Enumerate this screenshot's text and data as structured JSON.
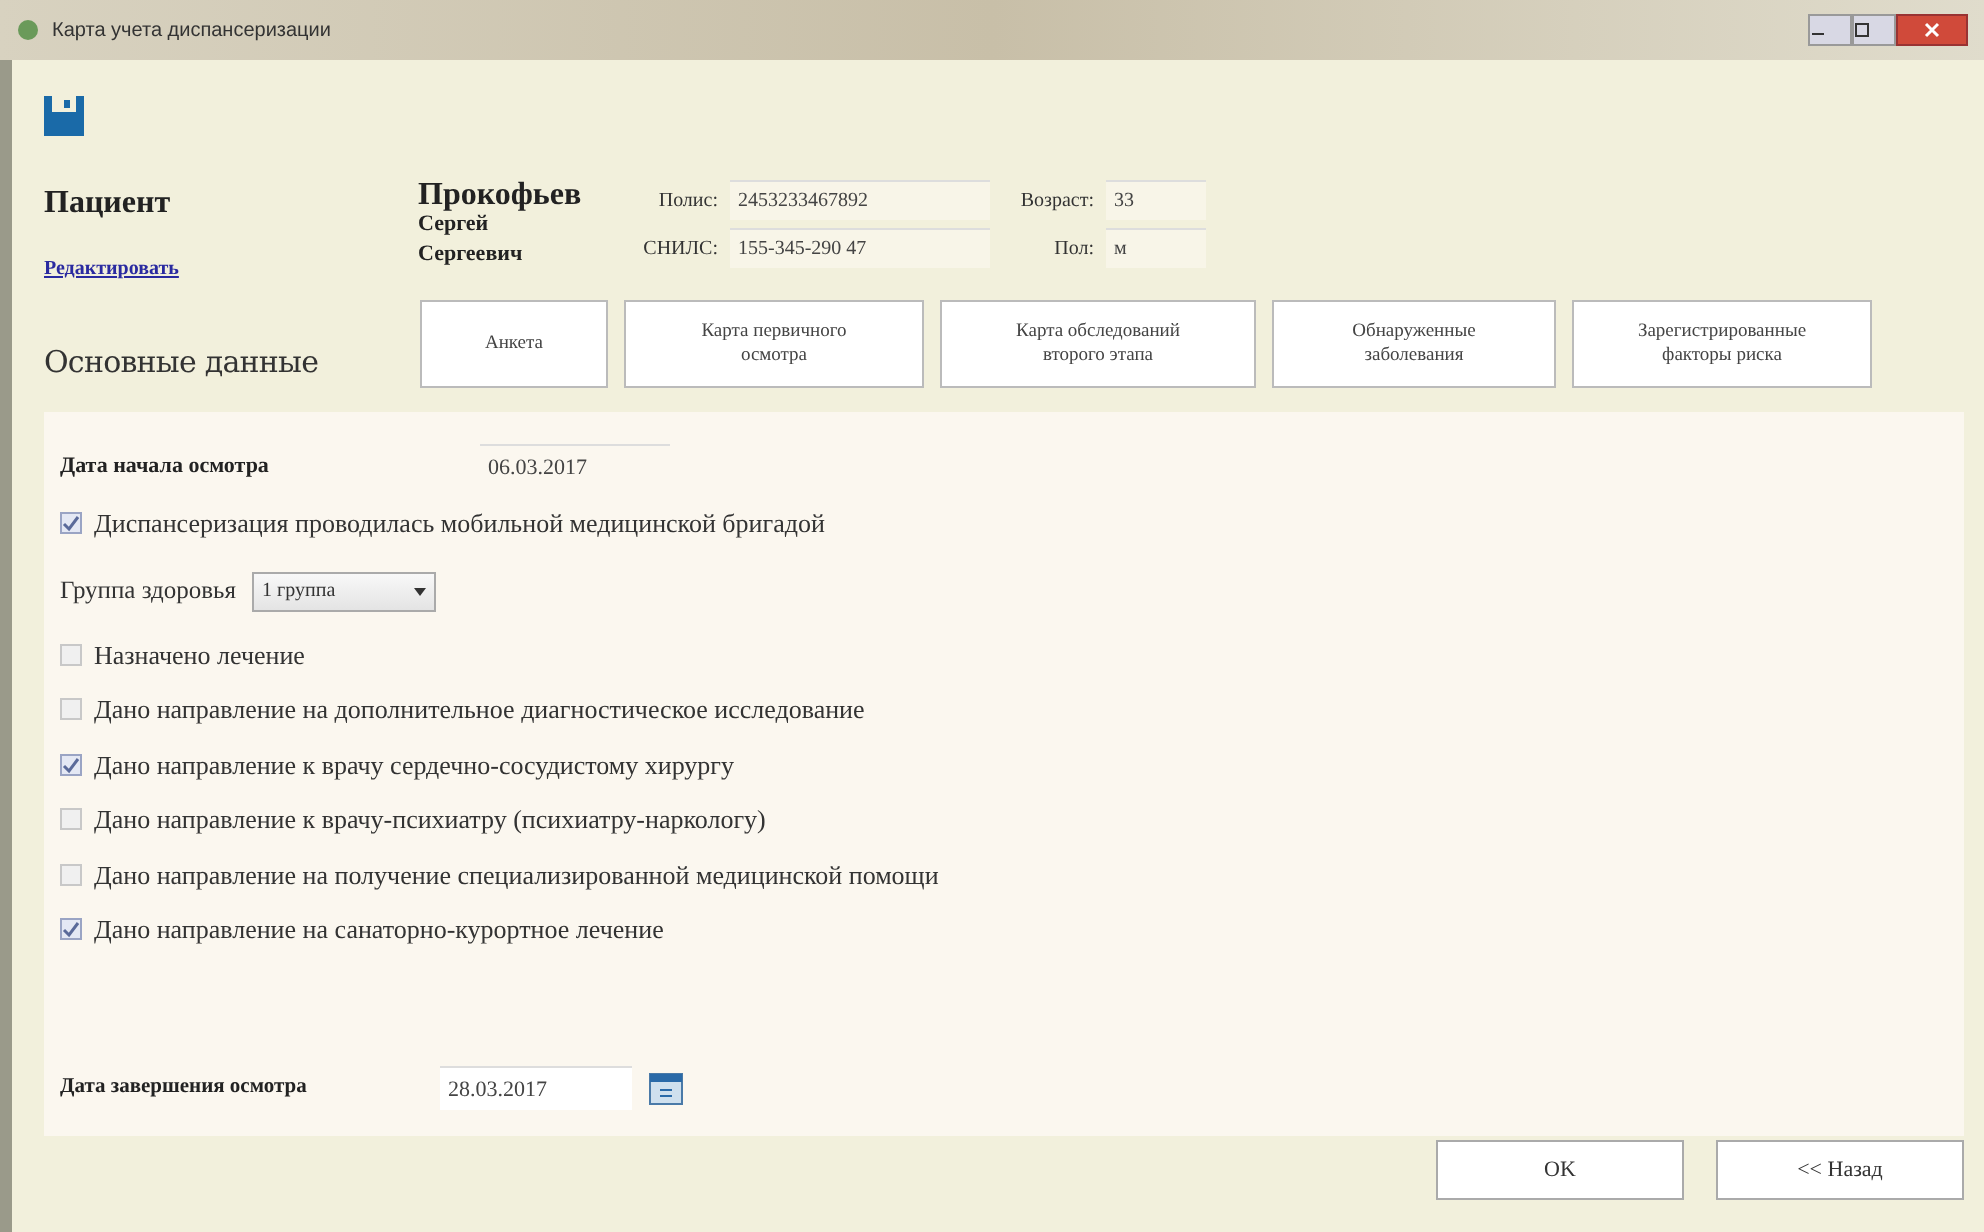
{
  "window": {
    "title": "Карта учета диспансеризации"
  },
  "patient": {
    "heading": "Пациент",
    "edit_link": "Редактировать",
    "last_name": "Прокофьев",
    "first_name": "Сергей",
    "patronymic": "Сергеевич",
    "fields": [
      {
        "label": "Полис:",
        "value": "2453233467892"
      },
      {
        "label": "СНИЛС:",
        "value": "155-345-290 47"
      }
    ],
    "small_fields": [
      {
        "label": "Возраст:",
        "value": "33"
      },
      {
        "label": "Пол:",
        "value": "м"
      }
    ]
  },
  "section_title": "Основные данные",
  "nav_buttons": [
    "Анкета",
    "Карта первичного осмотра",
    "Карта обследований второго этапа",
    "Обнаруженные заболевания",
    "Зарегистрированные факторы риска"
  ],
  "start_date": {
    "label": "Дата начала осмотра",
    "value": "06.03.2017"
  },
  "mobile_team": {
    "label": "Диспансеризация проводилась мобильной медицинской бригадой",
    "checked": true
  },
  "health_group": {
    "label": "Группа здоровья",
    "value": "1 группа"
  },
  "options": [
    {
      "label": "Назначено лечение",
      "checked": false
    },
    {
      "label": "Дано направление на дополнительное диагностическое исследование",
      "checked": false
    },
    {
      "label": "Дано направление к врачу сердечно-сосудистому хирургу",
      "checked": true
    },
    {
      "label": "Дано направление к врачу-психиатру (психиатру-наркологу)",
      "checked": false
    },
    {
      "label": "Дано направление на получение специализированной медицинской помощи",
      "checked": false
    },
    {
      "label": "Дано направление на санаторно-курортное лечение",
      "checked": true
    }
  ],
  "end_date": {
    "label": "Дата завершения осмотра",
    "value": "28.03.2017"
  },
  "buttons": [
    "OK",
    "<< Назад"
  ]
}
